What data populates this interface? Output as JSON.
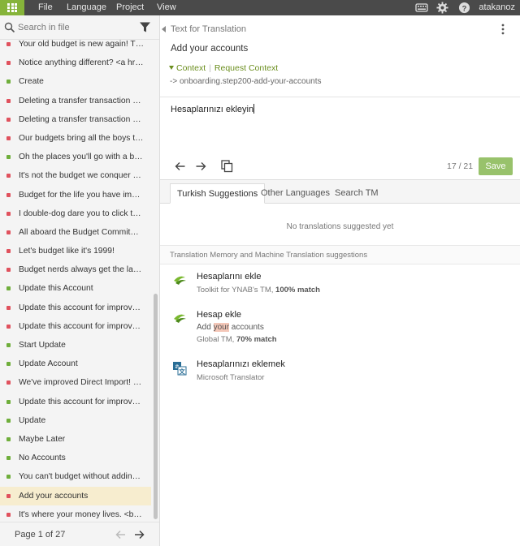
{
  "topbar": {
    "menus": [
      "File",
      "Language",
      "Project",
      "View"
    ],
    "username": "atakanoz",
    "icons": [
      "apps-grid-icon",
      "keyboard-icon",
      "gear-icon",
      "help-icon"
    ]
  },
  "search": {
    "placeholder": "Search in file"
  },
  "segments": [
    {
      "status": "red",
      "text": "Your old budget is new again! This is ..."
    },
    {
      "status": "red",
      "text": "Notice anything different? <a href=\"h..."
    },
    {
      "status": "green",
      "text": "Create"
    },
    {
      "status": "red",
      "text": "Deleting a transfer transaction will d..."
    },
    {
      "status": "red",
      "text": "Deleting a transfer transaction will d..."
    },
    {
      "status": "red",
      "text": "Our budgets bring all the boys to the..."
    },
    {
      "status": "green",
      "text": "Oh the places you'll go with a budget..."
    },
    {
      "status": "red",
      "text": "It's not the budget we conquer but o..."
    },
    {
      "status": "red",
      "text": "Budget for the life you have imagined."
    },
    {
      "status": "red",
      "text": "I double-dog dare you to click this bu..."
    },
    {
      "status": "red",
      "text": "All aboard the Budget Commitment ..."
    },
    {
      "status": "red",
      "text": "Let's budget like it's 1999!"
    },
    {
      "status": "red",
      "text": "Budget nerds always get the last laug..."
    },
    {
      "status": "green",
      "text": "Update this Account"
    },
    {
      "status": "red",
      "text": "Update this account for improved co..."
    },
    {
      "status": "red",
      "text": "Update this account for improved co..."
    },
    {
      "status": "green",
      "text": "Start Update"
    },
    {
      "status": "green",
      "text": "Update Account"
    },
    {
      "status": "red",
      "text": "We've improved Direct Import! Conn..."
    },
    {
      "status": "green",
      "text": "Update this account for improved co..."
    },
    {
      "status": "green",
      "text": "Update"
    },
    {
      "status": "green",
      "text": "Maybe Later"
    },
    {
      "status": "green",
      "text": "No Accounts"
    },
    {
      "status": "green",
      "text": "You can't budget without adding acc..."
    },
    {
      "status": "red",
      "text": "Add your accounts",
      "active": true
    },
    {
      "status": "red",
      "text": "It's where your money lives. <br/>Let..."
    }
  ],
  "pager": {
    "label": "Page 1 of 27"
  },
  "editor": {
    "header": "Text for Translation",
    "source_text": "Add your accounts",
    "context_label": "Context",
    "request_context_label": "Request Context",
    "context_key": "-> onboarding.step200-add-your-accounts",
    "translation": "Hesaplarınızı ekleyin",
    "counter": "17 / 21",
    "save_label": "Save"
  },
  "tabs": [
    {
      "label": "Turkish Suggestions",
      "active": true
    },
    {
      "label": "Other Languages",
      "active": false
    },
    {
      "label": "Search TM",
      "active": false
    }
  ],
  "suggestions_panel": {
    "empty_message": "No translations suggested yet",
    "tm_header": "Translation Memory and Machine Translation suggestions"
  },
  "tm_suggestions": [
    {
      "text": "Hesaplarını ekle",
      "source_prefix": "Toolkit for YNAB's TM,",
      "match": "100% match",
      "logo": "tm-logo-icon"
    },
    {
      "text": "Hesap ekle",
      "original_pre": "Add ",
      "original_highlight": "your",
      "original_post": " accounts",
      "source_prefix": "Global TM,",
      "match": "70% match",
      "logo": "tm-logo-icon"
    },
    {
      "text": "Hesaplarınızı eklemek",
      "source_prefix": "Microsoft Translator",
      "match": "",
      "logo": "translator-icon"
    }
  ],
  "colors": {
    "topbar": "#4a4a4a",
    "brand_green": "#86b43a",
    "save_button": "#98c26b",
    "status_red": "#e0515d",
    "status_green": "#6fae3b",
    "active_row": "#f7edcf",
    "context_green": "#6b8e1e"
  }
}
